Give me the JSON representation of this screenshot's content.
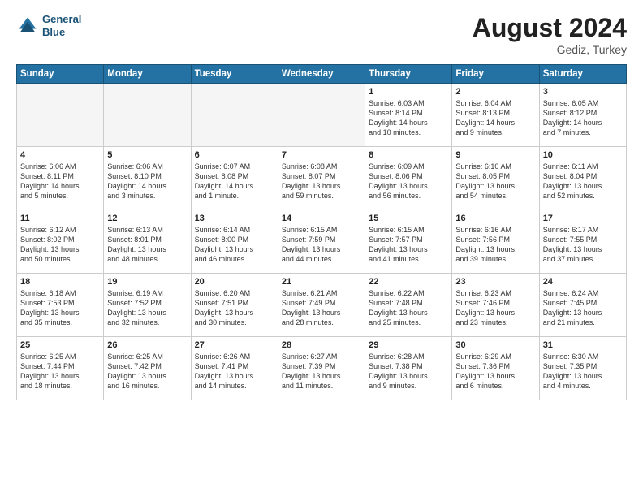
{
  "header": {
    "logo_line1": "General",
    "logo_line2": "Blue",
    "month_year": "August 2024",
    "location": "Gediz, Turkey"
  },
  "weekdays": [
    "Sunday",
    "Monday",
    "Tuesday",
    "Wednesday",
    "Thursday",
    "Friday",
    "Saturday"
  ],
  "weeks": [
    [
      {
        "day": "",
        "info": ""
      },
      {
        "day": "",
        "info": ""
      },
      {
        "day": "",
        "info": ""
      },
      {
        "day": "",
        "info": ""
      },
      {
        "day": "1",
        "info": "Sunrise: 6:03 AM\nSunset: 8:14 PM\nDaylight: 14 hours\nand 10 minutes."
      },
      {
        "day": "2",
        "info": "Sunrise: 6:04 AM\nSunset: 8:13 PM\nDaylight: 14 hours\nand 9 minutes."
      },
      {
        "day": "3",
        "info": "Sunrise: 6:05 AM\nSunset: 8:12 PM\nDaylight: 14 hours\nand 7 minutes."
      }
    ],
    [
      {
        "day": "4",
        "info": "Sunrise: 6:06 AM\nSunset: 8:11 PM\nDaylight: 14 hours\nand 5 minutes."
      },
      {
        "day": "5",
        "info": "Sunrise: 6:06 AM\nSunset: 8:10 PM\nDaylight: 14 hours\nand 3 minutes."
      },
      {
        "day": "6",
        "info": "Sunrise: 6:07 AM\nSunset: 8:08 PM\nDaylight: 14 hours\nand 1 minute."
      },
      {
        "day": "7",
        "info": "Sunrise: 6:08 AM\nSunset: 8:07 PM\nDaylight: 13 hours\nand 59 minutes."
      },
      {
        "day": "8",
        "info": "Sunrise: 6:09 AM\nSunset: 8:06 PM\nDaylight: 13 hours\nand 56 minutes."
      },
      {
        "day": "9",
        "info": "Sunrise: 6:10 AM\nSunset: 8:05 PM\nDaylight: 13 hours\nand 54 minutes."
      },
      {
        "day": "10",
        "info": "Sunrise: 6:11 AM\nSunset: 8:04 PM\nDaylight: 13 hours\nand 52 minutes."
      }
    ],
    [
      {
        "day": "11",
        "info": "Sunrise: 6:12 AM\nSunset: 8:02 PM\nDaylight: 13 hours\nand 50 minutes."
      },
      {
        "day": "12",
        "info": "Sunrise: 6:13 AM\nSunset: 8:01 PM\nDaylight: 13 hours\nand 48 minutes."
      },
      {
        "day": "13",
        "info": "Sunrise: 6:14 AM\nSunset: 8:00 PM\nDaylight: 13 hours\nand 46 minutes."
      },
      {
        "day": "14",
        "info": "Sunrise: 6:15 AM\nSunset: 7:59 PM\nDaylight: 13 hours\nand 44 minutes."
      },
      {
        "day": "15",
        "info": "Sunrise: 6:15 AM\nSunset: 7:57 PM\nDaylight: 13 hours\nand 41 minutes."
      },
      {
        "day": "16",
        "info": "Sunrise: 6:16 AM\nSunset: 7:56 PM\nDaylight: 13 hours\nand 39 minutes."
      },
      {
        "day": "17",
        "info": "Sunrise: 6:17 AM\nSunset: 7:55 PM\nDaylight: 13 hours\nand 37 minutes."
      }
    ],
    [
      {
        "day": "18",
        "info": "Sunrise: 6:18 AM\nSunset: 7:53 PM\nDaylight: 13 hours\nand 35 minutes."
      },
      {
        "day": "19",
        "info": "Sunrise: 6:19 AM\nSunset: 7:52 PM\nDaylight: 13 hours\nand 32 minutes."
      },
      {
        "day": "20",
        "info": "Sunrise: 6:20 AM\nSunset: 7:51 PM\nDaylight: 13 hours\nand 30 minutes."
      },
      {
        "day": "21",
        "info": "Sunrise: 6:21 AM\nSunset: 7:49 PM\nDaylight: 13 hours\nand 28 minutes."
      },
      {
        "day": "22",
        "info": "Sunrise: 6:22 AM\nSunset: 7:48 PM\nDaylight: 13 hours\nand 25 minutes."
      },
      {
        "day": "23",
        "info": "Sunrise: 6:23 AM\nSunset: 7:46 PM\nDaylight: 13 hours\nand 23 minutes."
      },
      {
        "day": "24",
        "info": "Sunrise: 6:24 AM\nSunset: 7:45 PM\nDaylight: 13 hours\nand 21 minutes."
      }
    ],
    [
      {
        "day": "25",
        "info": "Sunrise: 6:25 AM\nSunset: 7:44 PM\nDaylight: 13 hours\nand 18 minutes."
      },
      {
        "day": "26",
        "info": "Sunrise: 6:25 AM\nSunset: 7:42 PM\nDaylight: 13 hours\nand 16 minutes."
      },
      {
        "day": "27",
        "info": "Sunrise: 6:26 AM\nSunset: 7:41 PM\nDaylight: 13 hours\nand 14 minutes."
      },
      {
        "day": "28",
        "info": "Sunrise: 6:27 AM\nSunset: 7:39 PM\nDaylight: 13 hours\nand 11 minutes."
      },
      {
        "day": "29",
        "info": "Sunrise: 6:28 AM\nSunset: 7:38 PM\nDaylight: 13 hours\nand 9 minutes."
      },
      {
        "day": "30",
        "info": "Sunrise: 6:29 AM\nSunset: 7:36 PM\nDaylight: 13 hours\nand 6 minutes."
      },
      {
        "day": "31",
        "info": "Sunrise: 6:30 AM\nSunset: 7:35 PM\nDaylight: 13 hours\nand 4 minutes."
      }
    ]
  ]
}
